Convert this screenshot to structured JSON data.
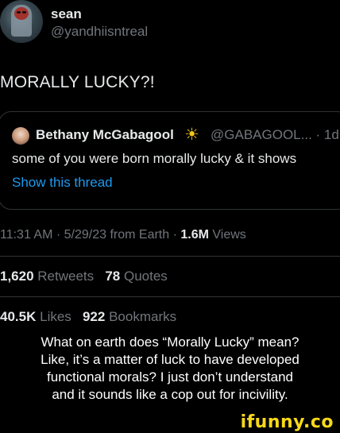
{
  "tweet": {
    "author_name": "sean",
    "author_handle": "@yandhiisntreal",
    "text": "MORALLY LUCKY?!"
  },
  "quoted": {
    "author_name": "Bethany McGabagool",
    "badge": "sun-icon",
    "handle_time": "@GABAGOOL... · 1d",
    "text": "some of you were born morally lucky & it shows",
    "link": "Show this thread"
  },
  "meta": {
    "time_date_source": "11:31 AM · 5/29/23 from Earth · ",
    "views_count": "1.6M",
    "views_label": " Views"
  },
  "stats": {
    "retweets_count": "1,620",
    "retweets_label": "Retweets",
    "quotes_count": "78",
    "quotes_label": "Quotes",
    "likes_count": "40.5K",
    "likes_label": "Likes",
    "bookmarks_count": "922",
    "bookmarks_label": "Bookmarks"
  },
  "caption": {
    "line1": "What on earth does “Morally Lucky” mean?",
    "line2": "Like, it’s a matter of luck to have developed",
    "line3": "functional morals? I just don’t understand",
    "line4": "and it sounds like a cop out for incivility."
  },
  "watermark": "ifunny.co",
  "colors": {
    "accent_link": "#1d9bf0",
    "muted": "#71767b",
    "logo": "#f7d81a"
  }
}
